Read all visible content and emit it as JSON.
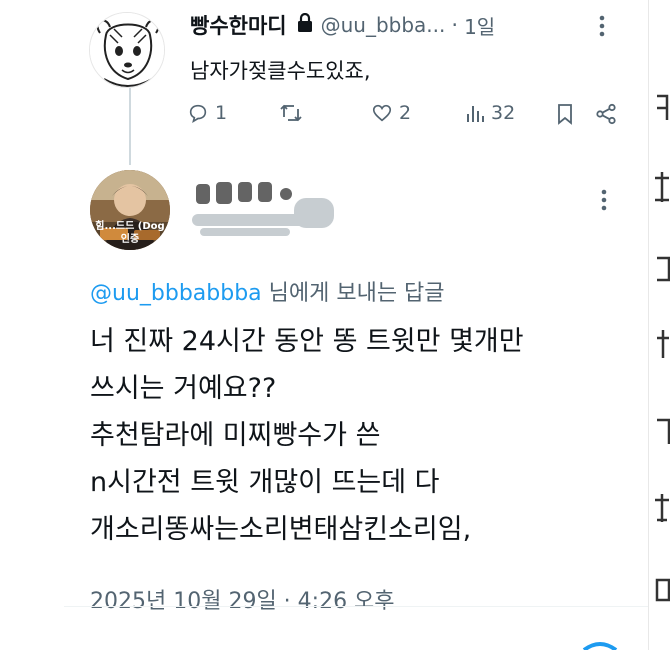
{
  "parent_tweet": {
    "display_name": "빵수한마디",
    "handle": "@uu_bbba...",
    "separator": "·",
    "time": "1일",
    "text": "남자가젖클수도있죠,",
    "stats": {
      "replies": "1",
      "retweets": "",
      "likes": "2",
      "views": "32"
    }
  },
  "reply_tweet": {
    "avatar_caption": "힘...드드 (Dog 인증",
    "reply_to_handle": "@uu_bbbabbba",
    "reply_to_suffix": " 님에게 보내는 답글",
    "body_lines": [
      "너 진짜 24시간 동안 똥 트윗만 몇개만",
      "쓰시는 거예요??",
      "추천탐라에 미찌빵수가 쓴",
      "n시간전 트윗 개많이 뜨는데 다",
      "개소리똥싸는소리변태삼킨소리임,"
    ],
    "timestamp": "2025년 10월 29일 · 4:26 오후"
  },
  "colors": {
    "accent": "#1d9bf0",
    "secondary_text": "#536471",
    "primary_text": "#0f1419",
    "thread_line": "#cfd9de"
  },
  "icons": {
    "lock": "lock-icon",
    "more": "more-vertical-icon",
    "reply": "reply-icon",
    "retweet": "retweet-icon",
    "like": "heart-icon",
    "views": "views-icon",
    "bookmark": "bookmark-icon",
    "share": "share-icon"
  }
}
